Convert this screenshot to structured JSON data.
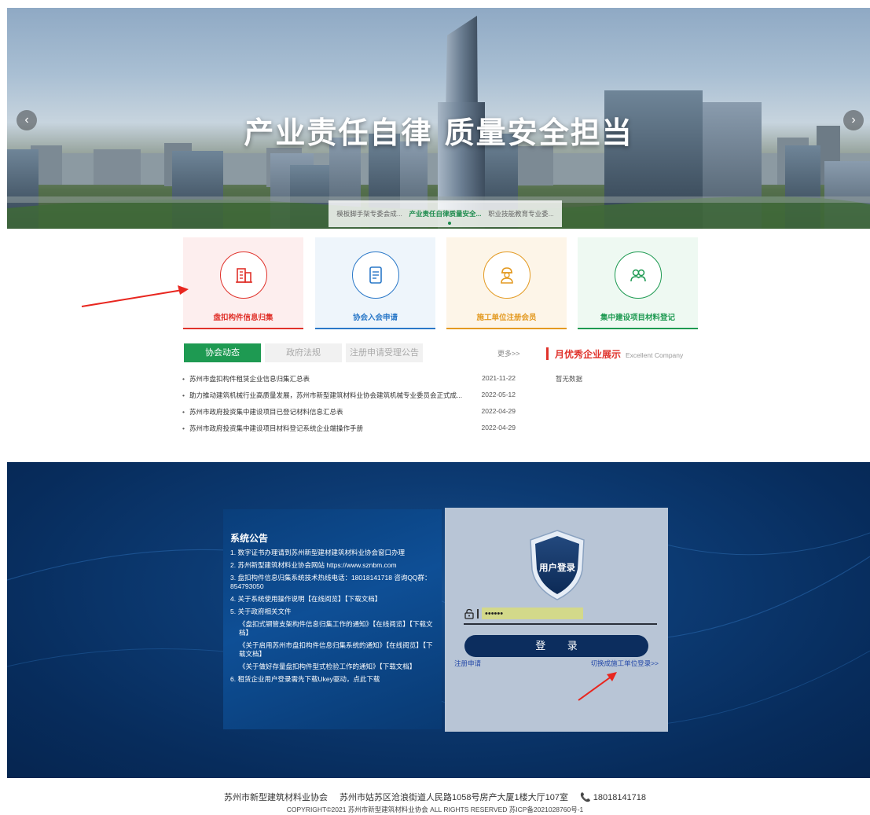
{
  "banner": {
    "title": "产业责任自律 质量安全担当",
    "prev_icon": "‹",
    "next_icon": "›",
    "tabs": [
      {
        "label": "模板脚手架专委会成...",
        "active": false
      },
      {
        "label": "产业责任自律质量安全...",
        "active": true
      },
      {
        "label": "职业技能教育专业委...",
        "active": false
      }
    ]
  },
  "quick_links": [
    {
      "label": "盘扣构件信息归集",
      "icon": "building-icon",
      "color": "#e0322b",
      "bg": "#fdeeee"
    },
    {
      "label": "协会入会申请",
      "icon": "document-icon",
      "color": "#2a78c8",
      "bg": "#eef5fb"
    },
    {
      "label": "施工单位注册会员",
      "icon": "worker-icon",
      "color": "#e39a22",
      "bg": "#fdf5e8"
    },
    {
      "label": "集中建设项目材料登记",
      "icon": "group-icon",
      "color": "#1e9a52",
      "bg": "#eef9f2"
    }
  ],
  "news": {
    "tabs": [
      {
        "label": "协会动态",
        "active": true
      },
      {
        "label": "政府法规",
        "active": false
      },
      {
        "label": "注册申请受理公告",
        "active": false
      }
    ],
    "more": "更多>>",
    "items": [
      {
        "title": "苏州市盘扣构件租赁企业信息归集汇总表",
        "date": "2021-11-22"
      },
      {
        "title": "助力推动建筑机械行业高质量发展，苏州市新型建筑材料业协会建筑机械专业委员会正式成...",
        "date": "2022-05-12"
      },
      {
        "title": "苏州市政府投资集中建设项目已登记材料信息汇总表",
        "date": "2022-04-29"
      },
      {
        "title": "苏州市政府投资集中建设项目材料登记系统企业端操作手册",
        "date": "2022-04-29"
      }
    ]
  },
  "excellent": {
    "title": "月优秀企业展示",
    "subtitle": "Excellent Company",
    "empty": "暂无数据"
  },
  "notice": {
    "title": "系统公告",
    "lines": [
      {
        "text": "1. 数字证书办理请到苏州新型建材建筑材料业协会窗口办理",
        "indent": false
      },
      {
        "text": "2. 苏州新型建筑材料业协会网站 https://www.sznbm.com",
        "indent": false
      },
      {
        "text": "3. 盘扣构件信息归集系统技术热线电话：18018141718 咨询QQ群：854793050",
        "indent": false
      },
      {
        "text": "4. 关于系统使用操作说明【在线阅览】【下载文档】",
        "indent": false
      },
      {
        "text": "5. 关于政府相关文件",
        "indent": false
      },
      {
        "text": "《盘扣式钢管支架构件信息归集工作的通知》【在线阅览】【下载文档】",
        "indent": true
      },
      {
        "text": "《关于启用苏州市盘扣构件信息归集系统的通知》【在线阅览】【下载文档】",
        "indent": true
      },
      {
        "text": "《关于做好存量盘扣构件型式检验工作的通知》【下载文档】",
        "indent": true
      },
      {
        "text": "6. 租赁企业用户登录需先下载Ukey驱动，点此下载",
        "indent": false
      }
    ]
  },
  "login": {
    "shield_label": "用户登录",
    "password_value": "••••••",
    "button": "登 录",
    "register": "注册申请",
    "switch": "切换成施工单位登录>>"
  },
  "footer": {
    "org": "苏州市新型建筑材料业协会",
    "address": "苏州市姑苏区沧浪街道人民路1058号房产大厦1楼大厅107室",
    "phone": "18018141718",
    "phone_icon": "phone-icon",
    "copyright": "COPYRIGHT©2021 苏州市新型建筑材料业协会 ALL RIGHTS RESERVED 苏ICP备2021028760号-1"
  },
  "colors": {
    "accent_green": "#1e9a52",
    "accent_red": "#e0322b",
    "login_bg": "#0c3a72"
  }
}
